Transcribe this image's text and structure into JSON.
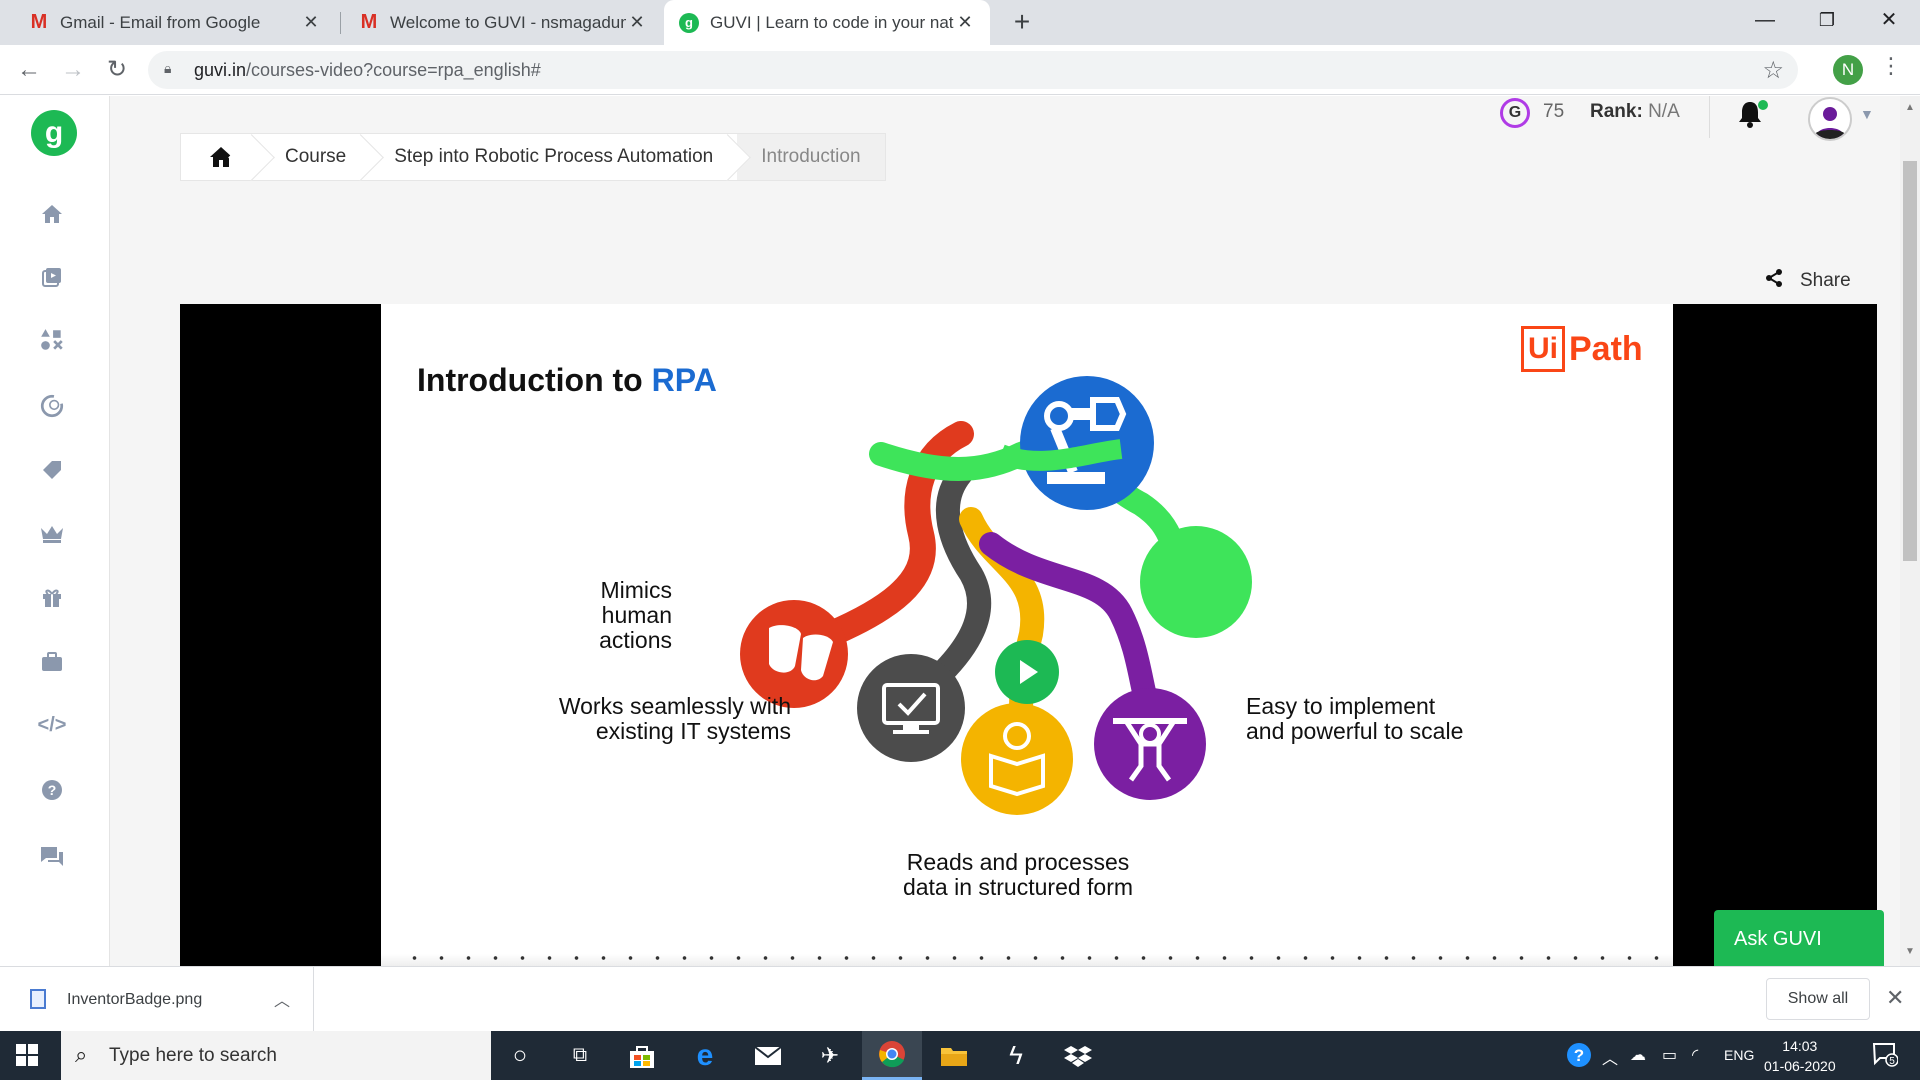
{
  "browser": {
    "tabs": [
      {
        "title": "Gmail - Email from Google",
        "icon": "gmail-icon",
        "active": false
      },
      {
        "title": "Welcome to GUVI - nsmagadum",
        "icon": "gmail-icon",
        "active": false
      },
      {
        "title": "GUVI | Learn to code in your nati",
        "icon": "guvi-icon",
        "active": true
      }
    ],
    "url_host": "guvi.in",
    "url_path": "/courses-video?course=rpa_english#",
    "profile_initial": "N"
  },
  "colors": {
    "brand": "#1db954",
    "accent_blue": "#1b6bd1",
    "uipath": "#fa4616"
  },
  "header": {
    "coins": "75",
    "rank_label": "Rank:",
    "rank_value": "N/A"
  },
  "breadcrumb": {
    "items": [
      "Course",
      "Step into Robotic Process Automation",
      "Introduction"
    ]
  },
  "share_label": "Share",
  "slide": {
    "title_prefix": "Introduction to ",
    "title_accent": "RPA",
    "logo_ui": "Ui",
    "logo_path": "Path",
    "captions": {
      "mimics_1": "Mimics human",
      "mimics_2": "actions",
      "works_1": "Works seamlessly with",
      "works_2": "existing IT systems",
      "reads_1": "Reads and processes",
      "reads_2": "data in structured form",
      "easy_1": "Easy to implement",
      "easy_2": "and powerful to scale"
    }
  },
  "ask_guvi": "Ask GUVI",
  "downloads": {
    "file_name": "InventorBadge.png",
    "show_all": "Show all"
  },
  "taskbar": {
    "search_placeholder": "Type here to search",
    "lang": "ENG",
    "time": "14:03",
    "date": "01-06-2020",
    "notifications": "5"
  }
}
